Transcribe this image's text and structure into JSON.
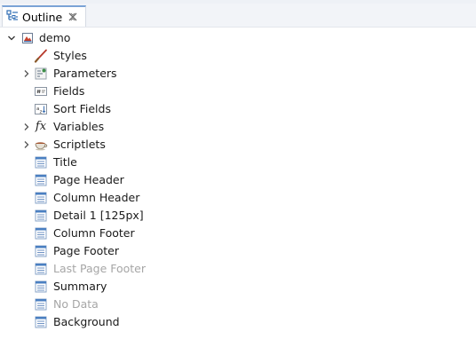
{
  "tab": {
    "title": "Outline"
  },
  "tree": {
    "root": {
      "label": "demo",
      "icon": "report-icon",
      "expanded": true
    },
    "items": [
      {
        "label": "Styles",
        "icon": "brush-icon",
        "expandable": false,
        "disabled": false
      },
      {
        "label": "Parameters",
        "icon": "parameters-icon",
        "expandable": true,
        "disabled": false
      },
      {
        "label": "Fields",
        "icon": "fields-icon",
        "expandable": false,
        "disabled": false
      },
      {
        "label": "Sort Fields",
        "icon": "sort-fields-icon",
        "expandable": false,
        "disabled": false
      },
      {
        "label": "Variables",
        "icon": "fx-icon",
        "expandable": true,
        "disabled": false
      },
      {
        "label": "Scriptlets",
        "icon": "scriptlet-cup-icon",
        "expandable": true,
        "disabled": false
      },
      {
        "label": "Title",
        "icon": "band-icon",
        "expandable": false,
        "disabled": false
      },
      {
        "label": "Page Header",
        "icon": "band-icon",
        "expandable": false,
        "disabled": false
      },
      {
        "label": "Column Header",
        "icon": "band-icon",
        "expandable": false,
        "disabled": false
      },
      {
        "label": "Detail 1 [125px]",
        "icon": "band-icon",
        "expandable": false,
        "disabled": false
      },
      {
        "label": "Column Footer",
        "icon": "band-icon",
        "expandable": false,
        "disabled": false
      },
      {
        "label": "Page Footer",
        "icon": "band-icon",
        "expandable": false,
        "disabled": false
      },
      {
        "label": "Last Page Footer",
        "icon": "band-icon",
        "expandable": false,
        "disabled": true
      },
      {
        "label": "Summary",
        "icon": "band-icon",
        "expandable": false,
        "disabled": false
      },
      {
        "label": "No Data",
        "icon": "band-icon",
        "expandable": false,
        "disabled": true
      },
      {
        "label": "Background",
        "icon": "band-icon",
        "expandable": false,
        "disabled": false
      }
    ]
  },
  "colors": {
    "tab_accent": "#7aa3d6",
    "disabled_text": "#a6a6a6",
    "band_blue": "#4a7fc1"
  }
}
